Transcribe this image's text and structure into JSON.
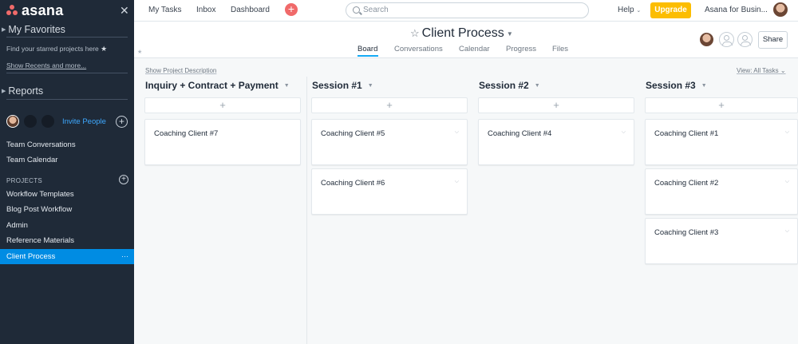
{
  "sidebar": {
    "logo_text": "asana",
    "favorites_heading": "My Favorites",
    "favorites_hint": "Find your starred projects here",
    "show_recents": "Show Recents and more...",
    "reports_heading": "Reports",
    "invite_label": "Invite People",
    "team_items": [
      "Team Conversations",
      "Team Calendar"
    ],
    "projects_heading": "PROJECTS",
    "projects": [
      "Workflow Templates",
      "Blog Post Workflow",
      "Admin",
      "Reference Materials",
      "Client Process"
    ],
    "active_project": "Client Process",
    "active_more": "···"
  },
  "topbar": {
    "nav": [
      "My Tasks",
      "Inbox",
      "Dashboard"
    ],
    "search_placeholder": "Search",
    "help": "Help",
    "upgrade": "Upgrade",
    "org": "Asana for Busin..."
  },
  "project": {
    "title": "Client Process",
    "tabs": [
      "Board",
      "Conversations",
      "Calendar",
      "Progress",
      "Files"
    ],
    "active_tab": "Board",
    "share": "Share"
  },
  "board": {
    "show_description": "Show Project Description",
    "view": "View: All Tasks",
    "columns": [
      {
        "title": "Inquiry + Contract + Payment",
        "cards": [
          "Coaching Client #7"
        ]
      },
      {
        "title": "Session #1",
        "cards": [
          "Coaching Client #5",
          "Coaching Client #6"
        ]
      },
      {
        "title": "Session #2",
        "cards": [
          "Coaching Client #4"
        ]
      },
      {
        "title": "Session #3",
        "cards": [
          "Coaching Client #1",
          "Coaching Client #2",
          "Coaching Client #3"
        ]
      }
    ]
  },
  "colors": {
    "sidebar_bg": "#1f2a38",
    "active_item": "#008ce3",
    "upgrade": "#fcbd01",
    "quick_add": "#f06a6a",
    "tab_underline": "#14aaf5"
  }
}
